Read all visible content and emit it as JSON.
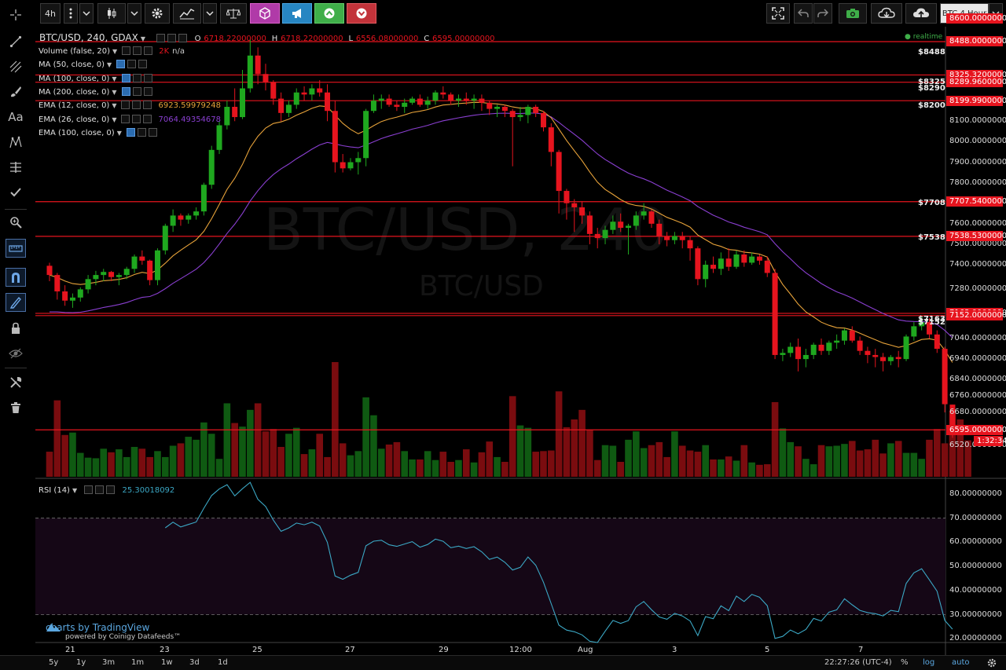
{
  "toolbar": {
    "interval": "4h",
    "chart_title_button": "BTC 4 Hour"
  },
  "symbol": {
    "name": "BTC/USD, 240, GDAX",
    "o_label": "O",
    "o_value": "6718.22000000",
    "h_label": "H",
    "h_value": "6718.22000000",
    "l_label": "L",
    "l_value": "6556.08000000",
    "c_label": "C",
    "c_value": "6595.00000000",
    "realtime": "realtime"
  },
  "indicators": [
    {
      "name": "Volume (false, 20)",
      "value": "2K",
      "extra": "n/a",
      "color": "#e6141e"
    },
    {
      "name": "MA (50, close, 0)",
      "value": "",
      "extra": "",
      "color": ""
    },
    {
      "name": "MA (100, close, 0)",
      "value": "",
      "extra": "",
      "color": ""
    },
    {
      "name": "MA (200, close, 0)",
      "value": "",
      "extra": "",
      "color": ""
    },
    {
      "name": "EMA (12, close, 0)",
      "value": "6923.59979248",
      "extra": "",
      "color": "#e8a33a"
    },
    {
      "name": "EMA (26, close, 0)",
      "value": "7064.49354678",
      "extra": "",
      "color": "#8a3fd1"
    },
    {
      "name": "EMA (100, close, 0)",
      "value": "",
      "extra": "",
      "color": ""
    }
  ],
  "watermark": {
    "line1": "BTC/USD, 240",
    "line2": "BTC/USD"
  },
  "price_axis": {
    "ticks": [
      "8100.00000000",
      "8000.00000000",
      "7900.00000000",
      "7800.00000000",
      "7600.00000000",
      "7500.00000000",
      "7400.00000000",
      "7280.00000000",
      "7040.00000000",
      "6940.00000000",
      "6840.00000000",
      "6760.00000000",
      "6680.00000000",
      "6520.00000000"
    ],
    "red_labels": [
      "8600.00000000",
      "8488.00000000",
      "8325.32000000",
      "8289.96000000",
      "8199.99000000",
      "7707.54000000",
      "7538.53000000",
      "7163.00000000",
      "7152.00000000",
      "6595.00000000",
      "1:32:34"
    ],
    "line_labels": [
      "$8488",
      "$8325",
      "$8290",
      "$8200",
      "$7708",
      "$7538",
      "$7163",
      "$7152"
    ]
  },
  "rsi": {
    "name": "RSI (14)",
    "value": "25.30018092",
    "ticks": [
      "80.00000000",
      "70.00000000",
      "60.00000000",
      "50.00000000",
      "40.00000000",
      "30.00000000",
      "20.00000000"
    ]
  },
  "time_axis": [
    "21",
    "23",
    "25",
    "27",
    "29",
    "12:00",
    "Aug",
    "3",
    "5",
    "7"
  ],
  "branding": {
    "main": "charts by TradingView",
    "sub": "powered by Coinigy Datafeeds™"
  },
  "bottom": {
    "ranges": [
      "5y",
      "1y",
      "3m",
      "1m",
      "1w",
      "3d",
      "1d"
    ],
    "clock": "22:27:26 (UTC-4)",
    "percent": "%",
    "log": "log",
    "auto": "auto"
  },
  "colors": {
    "up": "#1fa81f",
    "down": "#e6141e",
    "ema12": "#e8a33a",
    "ema26": "#8a3fd1",
    "rsi": "#3ba7c4",
    "hline": "#e6141e"
  },
  "chart_data": {
    "type": "candlestick",
    "candles": [
      [
        7395,
        7410,
        7320,
        7350
      ],
      [
        7350,
        7360,
        7230,
        7270
      ],
      [
        7270,
        7300,
        7200,
        7225
      ],
      [
        7225,
        7260,
        7190,
        7240
      ],
      [
        7240,
        7290,
        7220,
        7280
      ],
      [
        7280,
        7350,
        7260,
        7330
      ],
      [
        7330,
        7370,
        7300,
        7350
      ],
      [
        7350,
        7380,
        7320,
        7365
      ],
      [
        7365,
        7370,
        7320,
        7340
      ],
      [
        7340,
        7360,
        7300,
        7350
      ],
      [
        7350,
        7390,
        7330,
        7380
      ],
      [
        7380,
        7450,
        7360,
        7440
      ],
      [
        7440,
        7470,
        7400,
        7420
      ],
      [
        7420,
        7425,
        7300,
        7325
      ],
      [
        7325,
        7480,
        7300,
        7470
      ],
      [
        7470,
        7600,
        7450,
        7590
      ],
      [
        7590,
        7670,
        7560,
        7640
      ],
      [
        7640,
        7650,
        7590,
        7620
      ],
      [
        7620,
        7650,
        7600,
        7640
      ],
      [
        7640,
        7680,
        7620,
        7660
      ],
      [
        7660,
        7800,
        7640,
        7790
      ],
      [
        7790,
        7980,
        7770,
        7960
      ],
      [
        7960,
        8100,
        7940,
        8080
      ],
      [
        8080,
        8200,
        8060,
        8170
      ],
      [
        8170,
        8260,
        8100,
        8120
      ],
      [
        8120,
        8350,
        8110,
        8260
      ],
      [
        8260,
        8500,
        8240,
        8420
      ],
      [
        8420,
        8460,
        8280,
        8330
      ],
      [
        8330,
        8380,
        8250,
        8290
      ],
      [
        8290,
        8300,
        8180,
        8210
      ],
      [
        8210,
        8240,
        8100,
        8140
      ],
      [
        8140,
        8200,
        8120,
        8180
      ],
      [
        8180,
        8260,
        8160,
        8240
      ],
      [
        8240,
        8270,
        8200,
        8230
      ],
      [
        8230,
        8280,
        8200,
        8260
      ],
      [
        8260,
        8300,
        8220,
        8240
      ],
      [
        8240,
        8280,
        8100,
        8150
      ],
      [
        8150,
        8200,
        7850,
        7900
      ],
      [
        7900,
        7940,
        7850,
        7870
      ],
      [
        7870,
        7920,
        7860,
        7900
      ],
      [
        7900,
        7950,
        7840,
        7920
      ],
      [
        7920,
        8160,
        7880,
        8150
      ],
      [
        8150,
        8230,
        8140,
        8200
      ],
      [
        8200,
        8230,
        8160,
        8210
      ],
      [
        8210,
        8230,
        8170,
        8180
      ],
      [
        8180,
        8200,
        8150,
        8170
      ],
      [
        8170,
        8210,
        8140,
        8190
      ],
      [
        8190,
        8220,
        8180,
        8210
      ],
      [
        8210,
        8230,
        8170,
        8180
      ],
      [
        8180,
        8220,
        8160,
        8200
      ],
      [
        8200,
        8250,
        8180,
        8240
      ],
      [
        8240,
        8270,
        8210,
        8230
      ],
      [
        8230,
        8240,
        8180,
        8200
      ],
      [
        8200,
        8230,
        8170,
        8210
      ],
      [
        8210,
        8240,
        8180,
        8200
      ],
      [
        8200,
        8230,
        8160,
        8210
      ],
      [
        8210,
        8230,
        8150,
        8190
      ],
      [
        8190,
        8200,
        8130,
        8160
      ],
      [
        8160,
        8180,
        8120,
        8170
      ],
      [
        8170,
        8180,
        8120,
        8150
      ],
      [
        8150,
        8160,
        7880,
        8120
      ],
      [
        8120,
        8170,
        8100,
        8130
      ],
      [
        8130,
        8180,
        8090,
        8170
      ],
      [
        8170,
        8180,
        8120,
        8140
      ],
      [
        8140,
        8150,
        8050,
        8070
      ],
      [
        8070,
        8090,
        7880,
        7950
      ],
      [
        7950,
        7960,
        7650,
        7760
      ],
      [
        7760,
        7770,
        7620,
        7700
      ],
      [
        7700,
        7720,
        7560,
        7680
      ],
      [
        7680,
        7710,
        7600,
        7640
      ],
      [
        7640,
        7660,
        7500,
        7550
      ],
      [
        7550,
        7580,
        7480,
        7530
      ],
      [
        7530,
        7590,
        7500,
        7570
      ],
      [
        7570,
        7640,
        7550,
        7610
      ],
      [
        7610,
        7650,
        7560,
        7580
      ],
      [
        7580,
        7600,
        7450,
        7590
      ],
      [
        7590,
        7660,
        7570,
        7640
      ],
      [
        7640,
        7700,
        7620,
        7660
      ],
      [
        7660,
        7670,
        7580,
        7600
      ],
      [
        7600,
        7620,
        7500,
        7540
      ],
      [
        7540,
        7560,
        7490,
        7520
      ],
      [
        7520,
        7560,
        7500,
        7540
      ],
      [
        7540,
        7560,
        7480,
        7520
      ],
      [
        7520,
        7540,
        7420,
        7480
      ],
      [
        7480,
        7490,
        7300,
        7330
      ],
      [
        7330,
        7420,
        7290,
        7400
      ],
      [
        7400,
        7440,
        7360,
        7380
      ],
      [
        7380,
        7460,
        7350,
        7430
      ],
      [
        7430,
        7480,
        7370,
        7390
      ],
      [
        7390,
        7470,
        7380,
        7450
      ],
      [
        7450,
        7470,
        7390,
        7410
      ],
      [
        7410,
        7460,
        7400,
        7440
      ],
      [
        7440,
        7450,
        7400,
        7420
      ],
      [
        7420,
        7440,
        7340,
        7360
      ],
      [
        7360,
        7380,
        6940,
        6960
      ],
      [
        6960,
        6990,
        6930,
        6970
      ],
      [
        6970,
        7020,
        6950,
        7000
      ],
      [
        7000,
        7040,
        6880,
        6940
      ],
      [
        6940,
        6990,
        6900,
        6960
      ],
      [
        6960,
        7020,
        6940,
        7010
      ],
      [
        7010,
        7040,
        6960,
        6980
      ],
      [
        6980,
        7030,
        6960,
        7020
      ],
      [
        7020,
        7060,
        6990,
        7030
      ],
      [
        7030,
        7090,
        7010,
        7080
      ],
      [
        7080,
        7100,
        7020,
        7030
      ],
      [
        7030,
        7050,
        6960,
        6980
      ],
      [
        6980,
        7000,
        6920,
        6960
      ],
      [
        6960,
        6990,
        6900,
        6950
      ],
      [
        6950,
        6970,
        6880,
        6930
      ],
      [
        6930,
        6960,
        6910,
        6950
      ],
      [
        6950,
        6980,
        6900,
        6940
      ],
      [
        6940,
        7060,
        6930,
        7050
      ],
      [
        7050,
        7120,
        7030,
        7100
      ],
      [
        7100,
        7150,
        7080,
        7120
      ],
      [
        7120,
        7140,
        7040,
        7060
      ],
      [
        7060,
        7080,
        6970,
        6990
      ],
      [
        6990,
        7000,
        6680,
        6720
      ],
      [
        6718,
        6718,
        6556,
        6595
      ]
    ],
    "volumes": [
      420,
      1280,
      700,
      740,
      400,
      320,
      310,
      470,
      410,
      460,
      330,
      500,
      470,
      330,
      430,
      330,
      520,
      560,
      670,
      620,
      910,
      720,
      300,
      1230,
      900,
      840,
      1120,
      1230,
      760,
      800,
      500,
      720,
      820,
      380,
      460,
      720,
      330,
      1920,
      560,
      360,
      430,
      1330,
      1030,
      470,
      540,
      580,
      430,
      290,
      290,
      430,
      280,
      420,
      250,
      280,
      460,
      240,
      410,
      590,
      330,
      250,
      1350,
      860,
      820,
      420,
      430,
      440,
      1430,
      830,
      960,
      1120,
      790,
      280,
      530,
      520,
      250,
      620,
      760,
      480,
      530,
      580,
      330,
      760,
      520,
      440,
      420,
      530,
      290,
      290,
      340,
      270,
      530,
      240,
      200,
      210,
      1250,
      810,
      580,
      510,
      300,
      210,
      530,
      510,
      520,
      550,
      600,
      440,
      460,
      620,
      390,
      560,
      600,
      400,
      400,
      300,
      620,
      800,
      560,
      1100,
      960,
      610
    ]
  }
}
